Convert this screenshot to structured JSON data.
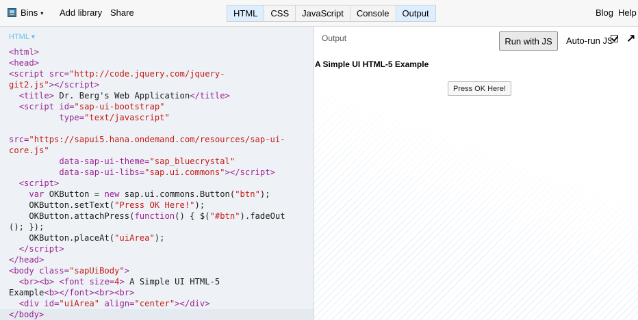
{
  "topbar": {
    "bins_label": "Bins",
    "bins_caret": "▾",
    "add_library": "Add library",
    "share": "Share",
    "panels": [
      "HTML",
      "CSS",
      "JavaScript",
      "Console",
      "Output"
    ],
    "active_panels": [
      "HTML",
      "Output"
    ],
    "blog": "Blog",
    "help": "Help"
  },
  "editor": {
    "label": "HTML ▾"
  },
  "output": {
    "label": "Output",
    "run_button": "Run with JS",
    "autorun_label": "Auto-run JS",
    "autorun_checked": true,
    "popout_icon": "↗",
    "page_heading": "A Simple UI HTML-5 Example",
    "press_button": "Press OK Here!"
  }
}
